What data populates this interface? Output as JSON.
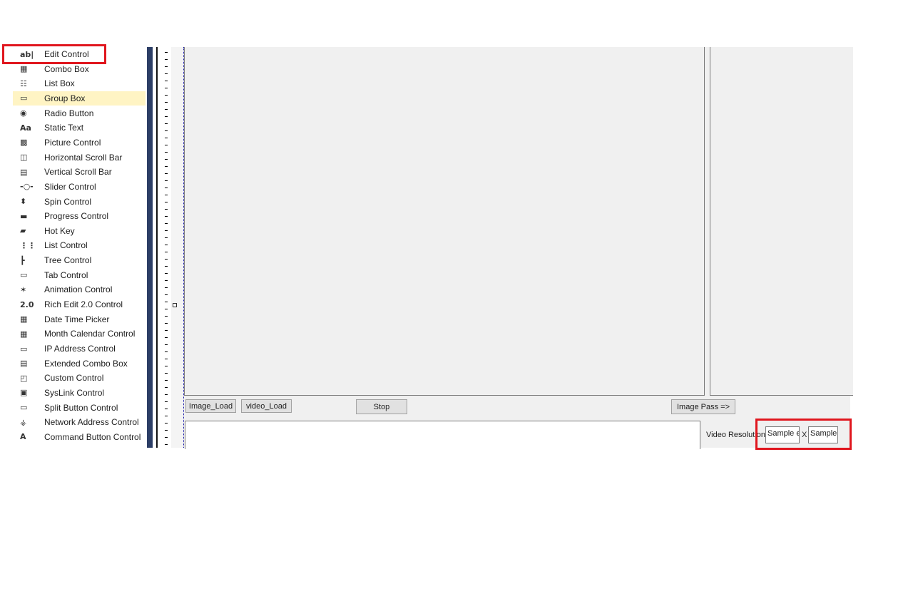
{
  "toolbox": {
    "items": [
      {
        "icon": "ab|",
        "label": "Edit Control"
      },
      {
        "icon": "▦",
        "label": "Combo Box"
      },
      {
        "icon": "☷",
        "label": "List Box"
      },
      {
        "icon": "▭",
        "label": "Group Box"
      },
      {
        "icon": "◉",
        "label": "Radio Button"
      },
      {
        "icon": "Aa",
        "label": "Static Text"
      },
      {
        "icon": "▩",
        "label": "Picture Control"
      },
      {
        "icon": "◫",
        "label": "Horizontal Scroll Bar"
      },
      {
        "icon": "▤",
        "label": "Vertical Scroll Bar"
      },
      {
        "icon": "-○-",
        "label": "Slider Control"
      },
      {
        "icon": "⬍",
        "label": "Spin Control"
      },
      {
        "icon": "▬",
        "label": "Progress Control"
      },
      {
        "icon": "▰",
        "label": "Hot Key"
      },
      {
        "icon": "⋮⋮",
        "label": "List Control"
      },
      {
        "icon": "┣",
        "label": "Tree Control"
      },
      {
        "icon": "▭",
        "label": "Tab Control"
      },
      {
        "icon": "✶",
        "label": "Animation Control"
      },
      {
        "icon": "2.0",
        "label": "Rich Edit 2.0 Control"
      },
      {
        "icon": "▦",
        "label": "Date Time Picker"
      },
      {
        "icon": "▦",
        "label": "Month Calendar Control"
      },
      {
        "icon": "▭",
        "label": "IP Address Control"
      },
      {
        "icon": "▤",
        "label": "Extended Combo Box"
      },
      {
        "icon": "◰",
        "label": "Custom Control"
      },
      {
        "icon": "▣",
        "label": "SysLink Control"
      },
      {
        "icon": "▭",
        "label": "Split Button Control"
      },
      {
        "icon": "⚶",
        "label": "Network Address Control"
      },
      {
        "icon": "A",
        "label": "Command Button Control"
      }
    ],
    "selected": "Group Box",
    "highlighted": "Edit Control"
  },
  "dialog": {
    "image_load": "Image_Load",
    "video_load": "video_Load",
    "stop": "Stop",
    "image_pass": "Image Pass =>",
    "video_resolution_label": "Video Resolution",
    "width_value": "Sample edit box",
    "x_label": "X",
    "height_value": "Sample"
  },
  "colors": {
    "highlight": "#e0161e",
    "selection": "#fff4c4",
    "navy": "#2c3e66"
  }
}
